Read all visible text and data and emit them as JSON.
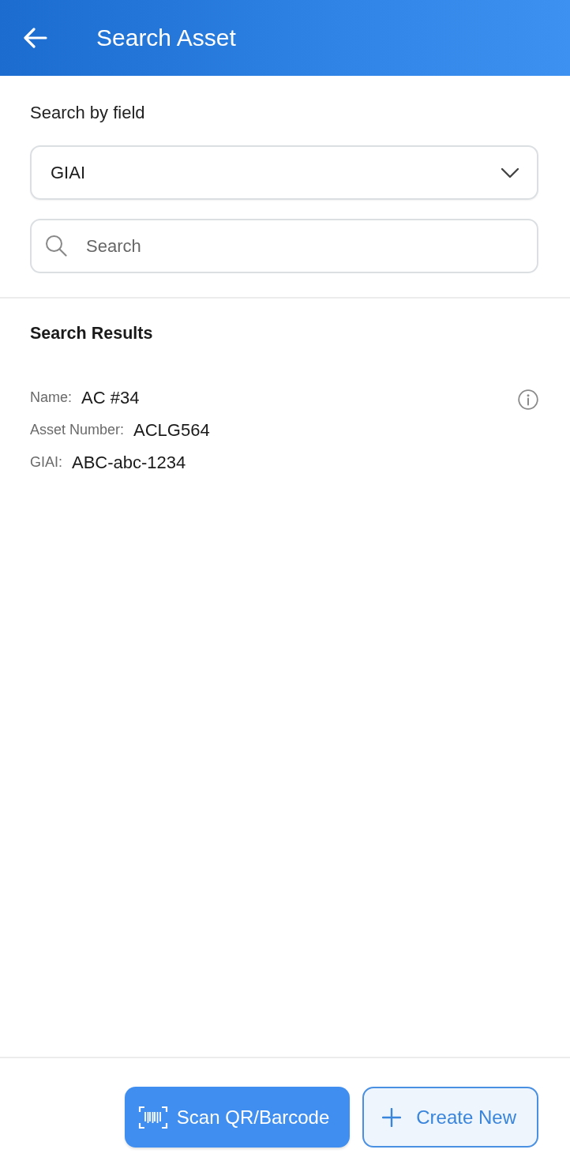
{
  "header": {
    "title": "Search Asset"
  },
  "search_by_field": {
    "label": "Search by field",
    "value": "GIAI"
  },
  "search": {
    "placeholder": "Search"
  },
  "results": {
    "title": "Search Results",
    "items": [
      {
        "fields": [
          {
            "label": "Name:",
            "value": "AC #34"
          },
          {
            "label": "Asset Number:",
            "value": "ACLG564"
          },
          {
            "label": "GIAI:",
            "value": "ABC-abc-1234"
          }
        ]
      }
    ]
  },
  "actions": [
    {
      "kind": "scan",
      "label": "Scan QR/Barcode"
    },
    {
      "kind": "create",
      "label": "Create New"
    }
  ]
}
